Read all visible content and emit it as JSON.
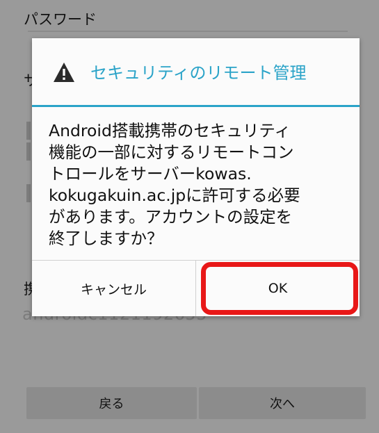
{
  "background": {
    "password_label": "パスワード",
    "server_label_fragment": "サ",
    "account_label_fragment": "携",
    "account_name_value": "androidc1121192655",
    "back_button": "戻る",
    "next_button": "次へ"
  },
  "dialog": {
    "title": "セキュリティのリモート管理",
    "icon": "warning-icon",
    "message": "Android搭載携帯のセキュリティ\n機能の一部に対するリモートコン\nトロールをサーバーkowas.\nkokugakuin.ac.jpに許可する必要\nがあります。アカウントの設定を\n終了しますか？",
    "cancel_button": "キャンセル",
    "ok_button": "OK"
  },
  "colors": {
    "accent": "#2aa3c8",
    "highlight": "#e81818"
  }
}
